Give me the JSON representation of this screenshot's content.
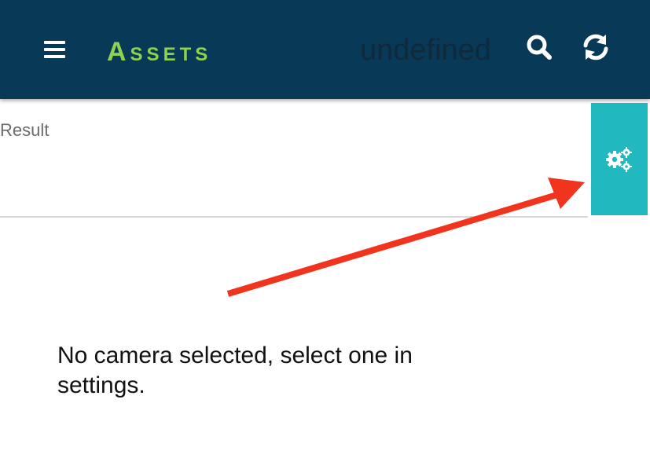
{
  "appbar": {
    "title": "Assets",
    "subtitle": "undefined",
    "background_color": "#083957",
    "title_color": "#8fd250",
    "menu_icon": "hamburger-menu-icon",
    "search_icon": "search-icon",
    "refresh_icon": "refresh-icon"
  },
  "result": {
    "label": "Result"
  },
  "settings": {
    "icon": "gears-icon",
    "background_color": "#21b8bf"
  },
  "annotation": {
    "arrow_color": "#f0341e"
  },
  "message": {
    "text": "No camera selected, select one in settings."
  }
}
